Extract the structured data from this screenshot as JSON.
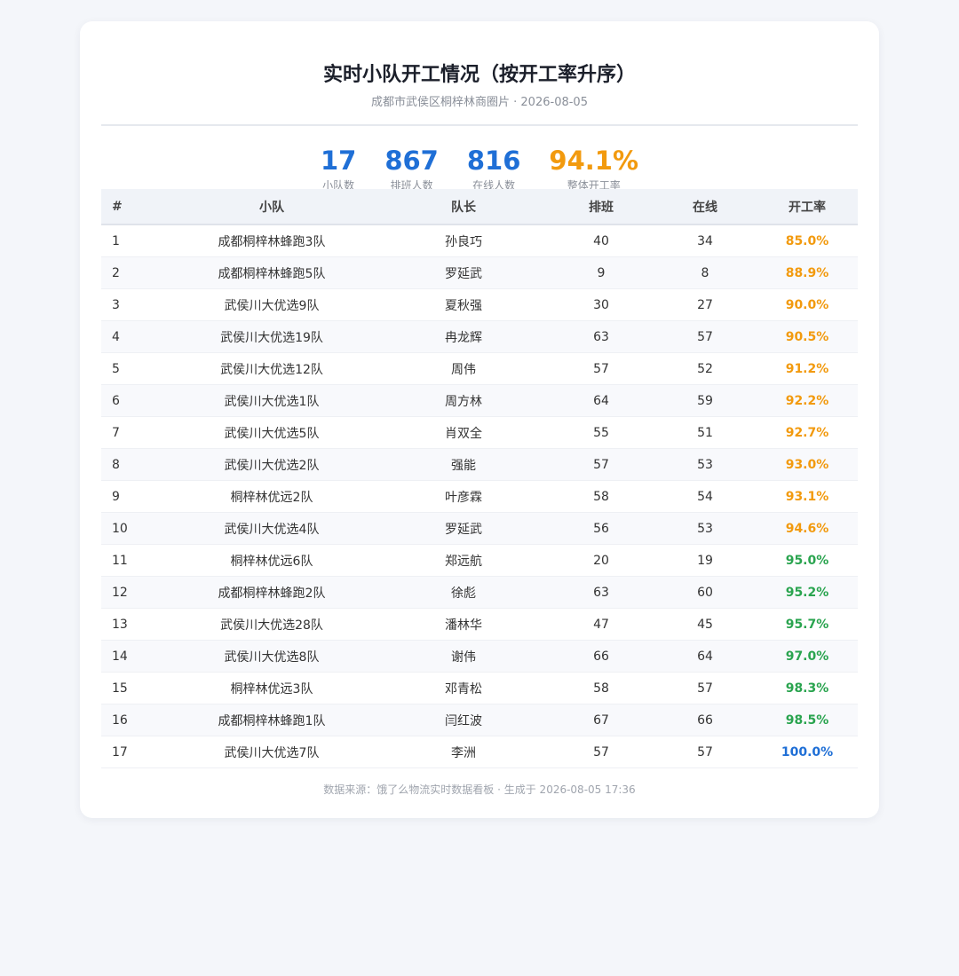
{
  "header": {
    "title": "实时小队开工情况（按开工率升序）",
    "subtitle": "成都市武侯区桐梓林商圈片 · 2026-08-05"
  },
  "stats": [
    {
      "value": "17",
      "label": "小队数",
      "color": "#1f6fd6"
    },
    {
      "value": "867",
      "label": "排班人数",
      "color": "#1f6fd6"
    },
    {
      "value": "816",
      "label": "在线人数",
      "color": "#1f6fd6"
    },
    {
      "value": "94.1%",
      "label": "整体开工率",
      "color": "#f29a0e"
    }
  ],
  "table": {
    "headers": [
      "#",
      "小队",
      "队长",
      "排班",
      "在线",
      "开工率"
    ],
    "rows": [
      {
        "idx": "1",
        "team": "成都桐梓林蜂跑3队",
        "leader": "孙良巧",
        "scheduled": "40",
        "online": "34",
        "rate": "85.0%",
        "level": "low"
      },
      {
        "idx": "2",
        "team": "成都桐梓林蜂跑5队",
        "leader": "罗延武",
        "scheduled": "9",
        "online": "8",
        "rate": "88.9%",
        "level": "low"
      },
      {
        "idx": "3",
        "team": "武侯川大优选9队",
        "leader": "夏秋强",
        "scheduled": "30",
        "online": "27",
        "rate": "90.0%",
        "level": "low"
      },
      {
        "idx": "4",
        "team": "武侯川大优选19队",
        "leader": "冉龙辉",
        "scheduled": "63",
        "online": "57",
        "rate": "90.5%",
        "level": "low"
      },
      {
        "idx": "5",
        "team": "武侯川大优选12队",
        "leader": "周伟",
        "scheduled": "57",
        "online": "52",
        "rate": "91.2%",
        "level": "low"
      },
      {
        "idx": "6",
        "team": "武侯川大优选1队",
        "leader": "周方林",
        "scheduled": "64",
        "online": "59",
        "rate": "92.2%",
        "level": "low"
      },
      {
        "idx": "7",
        "team": "武侯川大优选5队",
        "leader": "肖双全",
        "scheduled": "55",
        "online": "51",
        "rate": "92.7%",
        "level": "low"
      },
      {
        "idx": "8",
        "team": "武侯川大优选2队",
        "leader": "强能",
        "scheduled": "57",
        "online": "53",
        "rate": "93.0%",
        "level": "low"
      },
      {
        "idx": "9",
        "team": "桐梓林优远2队",
        "leader": "叶彦霖",
        "scheduled": "58",
        "online": "54",
        "rate": "93.1%",
        "level": "low"
      },
      {
        "idx": "10",
        "team": "武侯川大优选4队",
        "leader": "罗延武",
        "scheduled": "56",
        "online": "53",
        "rate": "94.6%",
        "level": "low"
      },
      {
        "idx": "11",
        "team": "桐梓林优远6队",
        "leader": "郑远航",
        "scheduled": "20",
        "online": "19",
        "rate": "95.0%",
        "level": "mid"
      },
      {
        "idx": "12",
        "team": "成都桐梓林蜂跑2队",
        "leader": "徐彪",
        "scheduled": "63",
        "online": "60",
        "rate": "95.2%",
        "level": "mid"
      },
      {
        "idx": "13",
        "team": "武侯川大优选28队",
        "leader": "潘林华",
        "scheduled": "47",
        "online": "45",
        "rate": "95.7%",
        "level": "mid"
      },
      {
        "idx": "14",
        "team": "武侯川大优选8队",
        "leader": "谢伟",
        "scheduled": "66",
        "online": "64",
        "rate": "97.0%",
        "level": "mid"
      },
      {
        "idx": "15",
        "team": "桐梓林优远3队",
        "leader": "邓青松",
        "scheduled": "58",
        "online": "57",
        "rate": "98.3%",
        "level": "mid"
      },
      {
        "idx": "16",
        "team": "成都桐梓林蜂跑1队",
        "leader": "闫红波",
        "scheduled": "67",
        "online": "66",
        "rate": "98.5%",
        "level": "mid"
      },
      {
        "idx": "17",
        "team": "武侯川大优选7队",
        "leader": "李洲",
        "scheduled": "57",
        "online": "57",
        "rate": "100.0%",
        "level": "full"
      }
    ]
  },
  "colors": {
    "rate_low": "#f29a0e",
    "rate_mid": "#2aa44f",
    "rate_full": "#1f6fd6",
    "stat_blue": "#1f6fd6",
    "stat_orange": "#f29a0e"
  },
  "footer": {
    "text": "数据来源：饿了么物流实时数据看板 · 生成于 2026-08-05 17:36"
  }
}
